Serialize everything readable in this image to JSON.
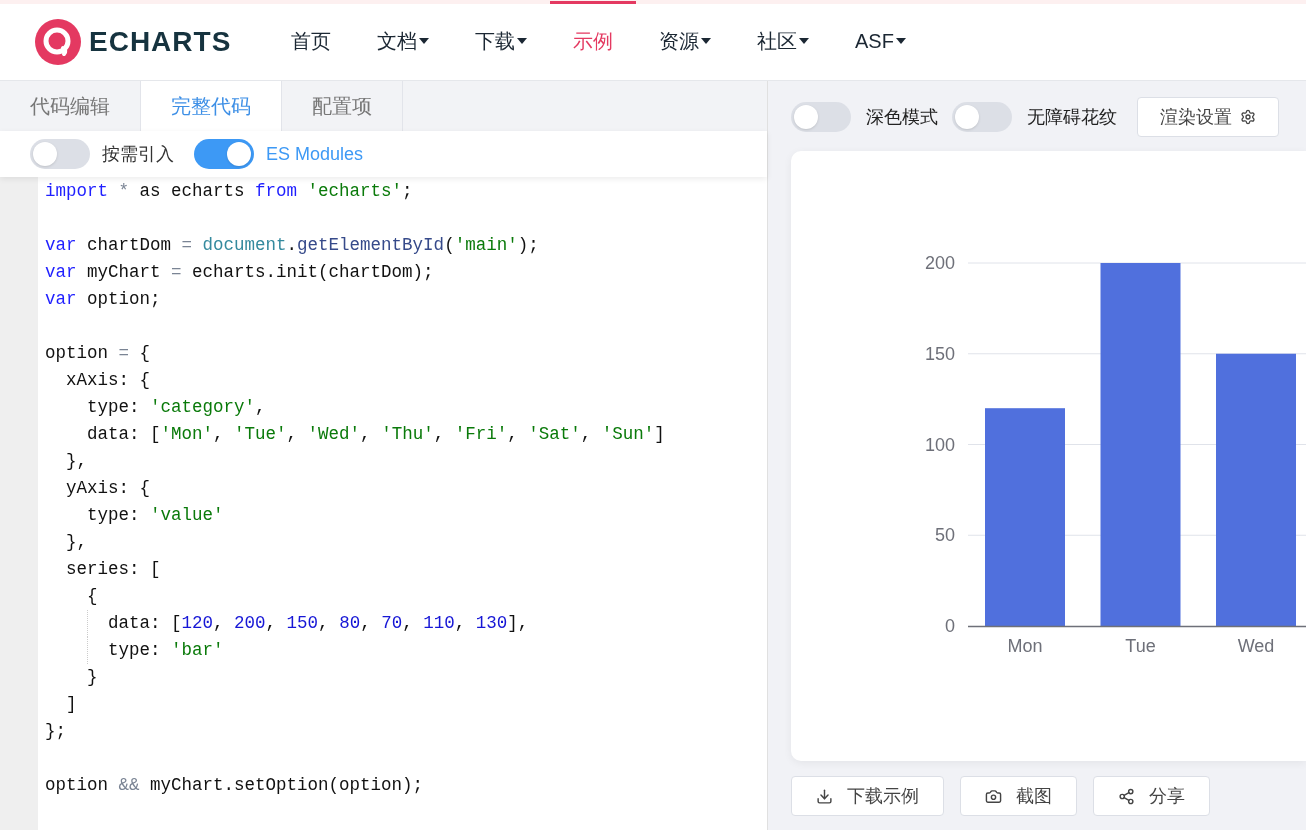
{
  "header": {
    "logo_text": "ECHARTS",
    "nav": [
      {
        "label": "首页",
        "dropdown": false,
        "selected": false
      },
      {
        "label": "文档",
        "dropdown": true,
        "selected": false
      },
      {
        "label": "下载",
        "dropdown": true,
        "selected": false
      },
      {
        "label": "示例",
        "dropdown": false,
        "selected": true
      },
      {
        "label": "资源",
        "dropdown": true,
        "selected": false
      },
      {
        "label": "社区",
        "dropdown": true,
        "selected": false
      },
      {
        "label": "ASF",
        "dropdown": true,
        "selected": false
      }
    ]
  },
  "editor": {
    "tabs": [
      {
        "label": "代码编辑",
        "selected": false
      },
      {
        "label": "完整代码",
        "selected": true
      },
      {
        "label": "配置项",
        "selected": false
      }
    ],
    "toggles": [
      {
        "label": "按需引入",
        "on": false
      },
      {
        "label": "ES Modules",
        "on": true
      }
    ],
    "code": [
      {
        "gap_before": false,
        "guide": false,
        "tokens": [
          {
            "text": "import",
            "kind": "keyword"
          },
          {
            "text": " *",
            "kind": "operator"
          },
          {
            "text": " as echarts ",
            "kind": "plain"
          },
          {
            "text": "from",
            "kind": "keyword"
          },
          {
            "text": " 'echarts'",
            "kind": "string"
          },
          {
            "text": ";",
            "kind": "plain"
          }
        ]
      },
      {
        "gap_before": true,
        "guide": false,
        "tokens": [
          {
            "text": "var",
            "kind": "keyword"
          },
          {
            "text": " chartDom ",
            "kind": "plain"
          },
          {
            "text": "=",
            "kind": "operator"
          },
          {
            "text": " document",
            "kind": "builtin"
          },
          {
            "text": ".",
            "kind": "plain"
          },
          {
            "text": "getElementById",
            "kind": "method"
          },
          {
            "text": "(",
            "kind": "plain"
          },
          {
            "text": "'main'",
            "kind": "string"
          },
          {
            "text": ");",
            "kind": "plain"
          }
        ]
      },
      {
        "gap_before": false,
        "guide": false,
        "tokens": [
          {
            "text": "var",
            "kind": "keyword"
          },
          {
            "text": " myChart ",
            "kind": "plain"
          },
          {
            "text": "=",
            "kind": "operator"
          },
          {
            "text": " echarts.init(chartDom);",
            "kind": "plain"
          }
        ]
      },
      {
        "gap_before": false,
        "guide": false,
        "tokens": [
          {
            "text": "var",
            "kind": "keyword"
          },
          {
            "text": " option;",
            "kind": "plain"
          }
        ]
      },
      {
        "gap_before": true,
        "guide": false,
        "tokens": [
          {
            "text": "option ",
            "kind": "plain"
          },
          {
            "text": "=",
            "kind": "operator"
          },
          {
            "text": " {",
            "kind": "plain"
          }
        ]
      },
      {
        "gap_before": false,
        "guide": false,
        "tokens": [
          {
            "text": "  xAxis: {",
            "kind": "plain"
          }
        ]
      },
      {
        "gap_before": false,
        "guide": false,
        "tokens": [
          {
            "text": "    type: ",
            "kind": "plain"
          },
          {
            "text": "'category'",
            "kind": "string"
          },
          {
            "text": ",",
            "kind": "plain"
          }
        ]
      },
      {
        "gap_before": false,
        "guide": false,
        "tokens": [
          {
            "text": "    data: [",
            "kind": "plain"
          },
          {
            "text": "'Mon'",
            "kind": "string"
          },
          {
            "text": ", ",
            "kind": "plain"
          },
          {
            "text": "'Tue'",
            "kind": "string"
          },
          {
            "text": ", ",
            "kind": "plain"
          },
          {
            "text": "'Wed'",
            "kind": "string"
          },
          {
            "text": ", ",
            "kind": "plain"
          },
          {
            "text": "'Thu'",
            "kind": "string"
          },
          {
            "text": ", ",
            "kind": "plain"
          },
          {
            "text": "'Fri'",
            "kind": "string"
          },
          {
            "text": ", ",
            "kind": "plain"
          },
          {
            "text": "'Sat'",
            "kind": "string"
          },
          {
            "text": ", ",
            "kind": "plain"
          },
          {
            "text": "'Sun'",
            "kind": "string"
          },
          {
            "text": "]",
            "kind": "plain"
          }
        ]
      },
      {
        "gap_before": false,
        "guide": false,
        "tokens": [
          {
            "text": "  },",
            "kind": "plain"
          }
        ]
      },
      {
        "gap_before": false,
        "guide": false,
        "tokens": [
          {
            "text": "  yAxis: {",
            "kind": "plain"
          }
        ]
      },
      {
        "gap_before": false,
        "guide": false,
        "tokens": [
          {
            "text": "    type: ",
            "kind": "plain"
          },
          {
            "text": "'value'",
            "kind": "string"
          }
        ]
      },
      {
        "gap_before": false,
        "guide": false,
        "tokens": [
          {
            "text": "  },",
            "kind": "plain"
          }
        ]
      },
      {
        "gap_before": false,
        "guide": false,
        "tokens": [
          {
            "text": "  series: [",
            "kind": "plain"
          }
        ]
      },
      {
        "gap_before": false,
        "guide": false,
        "tokens": [
          {
            "text": "    {",
            "kind": "plain"
          }
        ]
      },
      {
        "gap_before": false,
        "guide": true,
        "tokens": [
          {
            "text": "      data: [",
            "kind": "plain"
          },
          {
            "text": "120",
            "kind": "number"
          },
          {
            "text": ", ",
            "kind": "plain"
          },
          {
            "text": "200",
            "kind": "number"
          },
          {
            "text": ", ",
            "kind": "plain"
          },
          {
            "text": "150",
            "kind": "number"
          },
          {
            "text": ", ",
            "kind": "plain"
          },
          {
            "text": "80",
            "kind": "number"
          },
          {
            "text": ", ",
            "kind": "plain"
          },
          {
            "text": "70",
            "kind": "number"
          },
          {
            "text": ", ",
            "kind": "plain"
          },
          {
            "text": "110",
            "kind": "number"
          },
          {
            "text": ", ",
            "kind": "plain"
          },
          {
            "text": "130",
            "kind": "number"
          },
          {
            "text": "],",
            "kind": "plain"
          }
        ]
      },
      {
        "gap_before": false,
        "guide": true,
        "tokens": [
          {
            "text": "      type: ",
            "kind": "plain"
          },
          {
            "text": "'bar'",
            "kind": "string"
          }
        ]
      },
      {
        "gap_before": false,
        "guide": false,
        "tokens": [
          {
            "text": "    }",
            "kind": "plain"
          }
        ]
      },
      {
        "gap_before": false,
        "guide": false,
        "tokens": [
          {
            "text": "  ]",
            "kind": "plain"
          }
        ]
      },
      {
        "gap_before": false,
        "guide": false,
        "tokens": [
          {
            "text": "};",
            "kind": "plain"
          }
        ]
      },
      {
        "gap_before": true,
        "guide": false,
        "tokens": [
          {
            "text": "option ",
            "kind": "plain"
          },
          {
            "text": "&&",
            "kind": "operator"
          },
          {
            "text": " myChart.setOption(option);",
            "kind": "plain"
          }
        ]
      }
    ]
  },
  "preview": {
    "toggles": [
      {
        "label": "深色模式",
        "on": false
      },
      {
        "label": "无障碍花纹",
        "on": false
      }
    ],
    "render_settings": "渲染设置",
    "chart_data": {
      "type": "bar",
      "categories": [
        "Mon",
        "Tue",
        "Wed"
      ],
      "series": [
        {
          "color": "#5070dd",
          "values": [
            120,
            200,
            150
          ]
        }
      ],
      "grid": true,
      "ylim": [
        0,
        200
      ],
      "yticks": [
        0,
        50,
        100,
        150,
        200
      ]
    },
    "actions": [
      {
        "label": "下载示例",
        "kind": "download"
      },
      {
        "label": "截图",
        "kind": "camera"
      },
      {
        "label": "分享",
        "kind": "share"
      }
    ]
  }
}
